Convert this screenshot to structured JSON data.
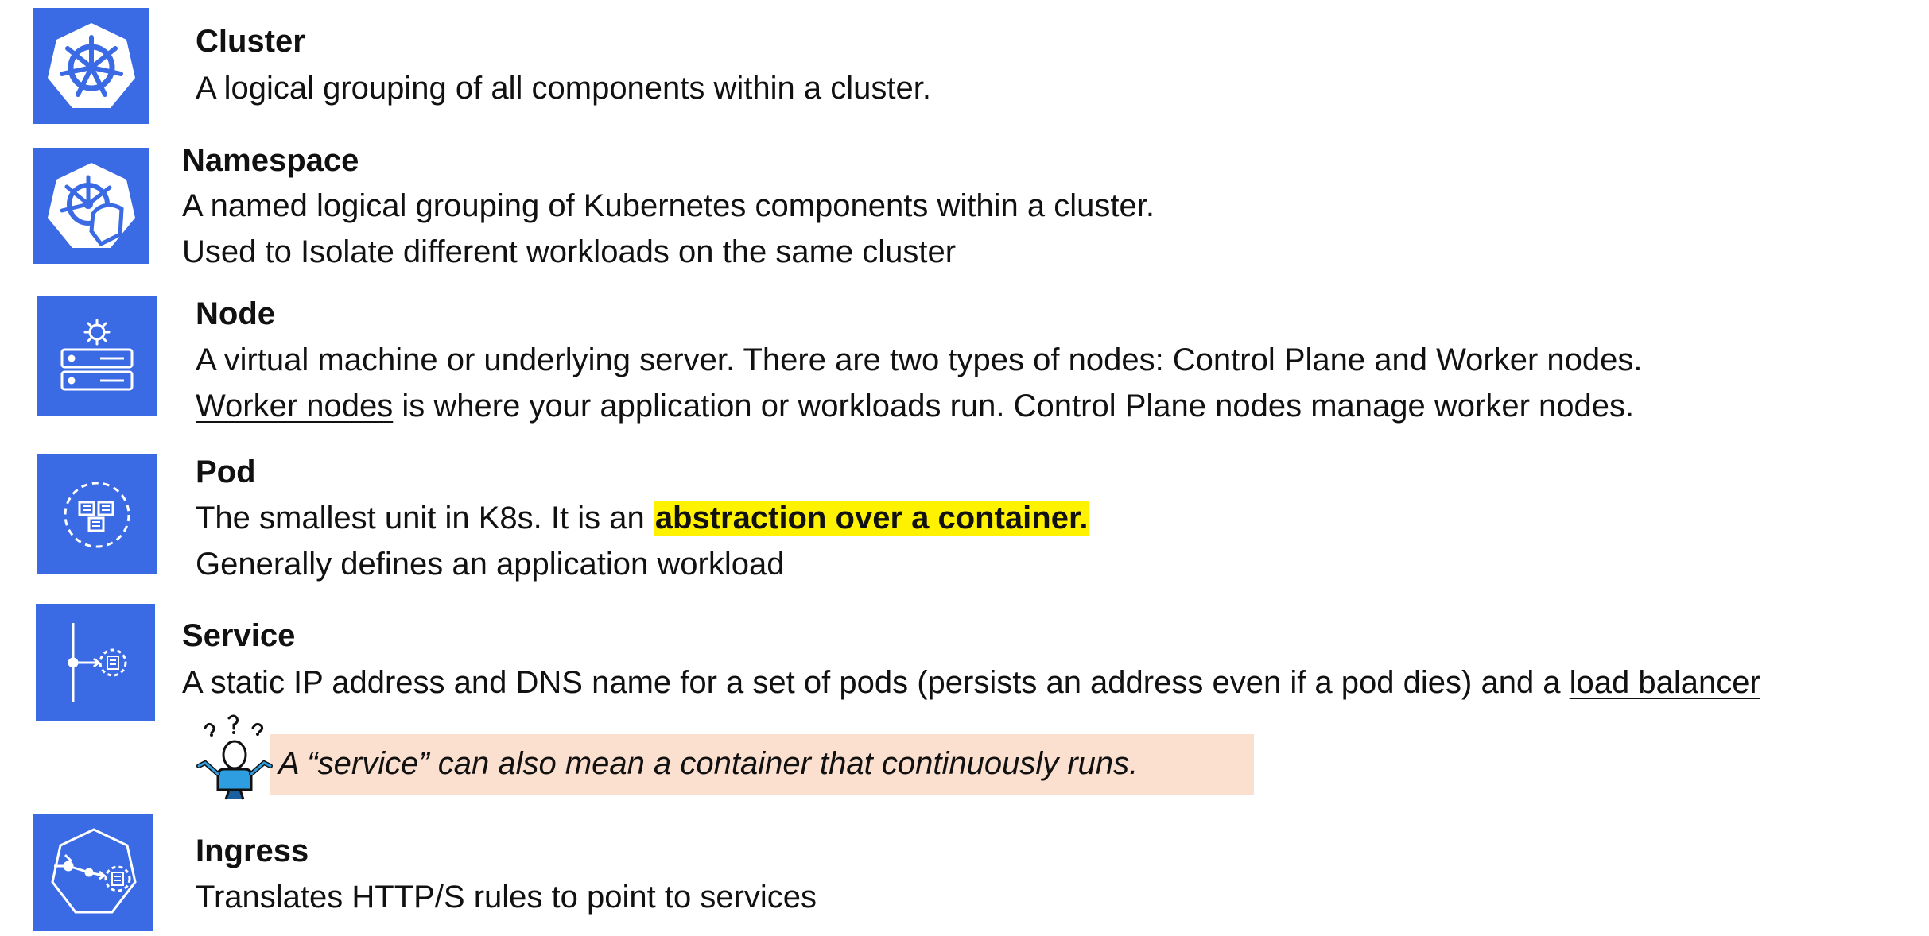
{
  "items": [
    {
      "title": "Cluster",
      "icon": "kubernetes-helm-icon",
      "lines": [
        "A logical grouping of all components within a cluster."
      ]
    },
    {
      "title": "Namespace",
      "icon": "kubernetes-namespace-icon",
      "lines": [
        "A named logical grouping of Kubernetes components within a cluster.",
        "Used to Isolate different workloads on the same cluster"
      ]
    },
    {
      "title": "Node",
      "icon": "server-gear-icon",
      "lines": [
        "A virtual machine or underlying server.  There are two types of nodes: Control Plane and Worker nodes.",
        " is where your application or workloads run. Control Plane nodes manage worker nodes."
      ],
      "underlined_prefix": "Worker nodes"
    },
    {
      "title": "Pod",
      "icon": "pod-icon",
      "line1_prefix": "The smallest unit in K8s. It is an ",
      "line1_highlight": "abstraction over a container.",
      "lines": [
        "Generally defines an application workload"
      ]
    },
    {
      "title": "Service",
      "icon": "service-icon",
      "line1_prefix": "A static IP address and DNS name for a set of pods (persists an address even if a pod dies) and a ",
      "line1_underlined": "load balancer"
    },
    {
      "title": "Ingress",
      "icon": "ingress-icon",
      "lines": [
        "Translates HTTP/S rules to point to services"
      ]
    }
  ],
  "note": {
    "text": "A “service” can also mean a container that continuously runs.",
    "icon": "confused-person-icon"
  },
  "colors": {
    "icon_bg": "#3a6ae4",
    "highlight": "#fff200",
    "note_bg": "#fbdfcf"
  }
}
